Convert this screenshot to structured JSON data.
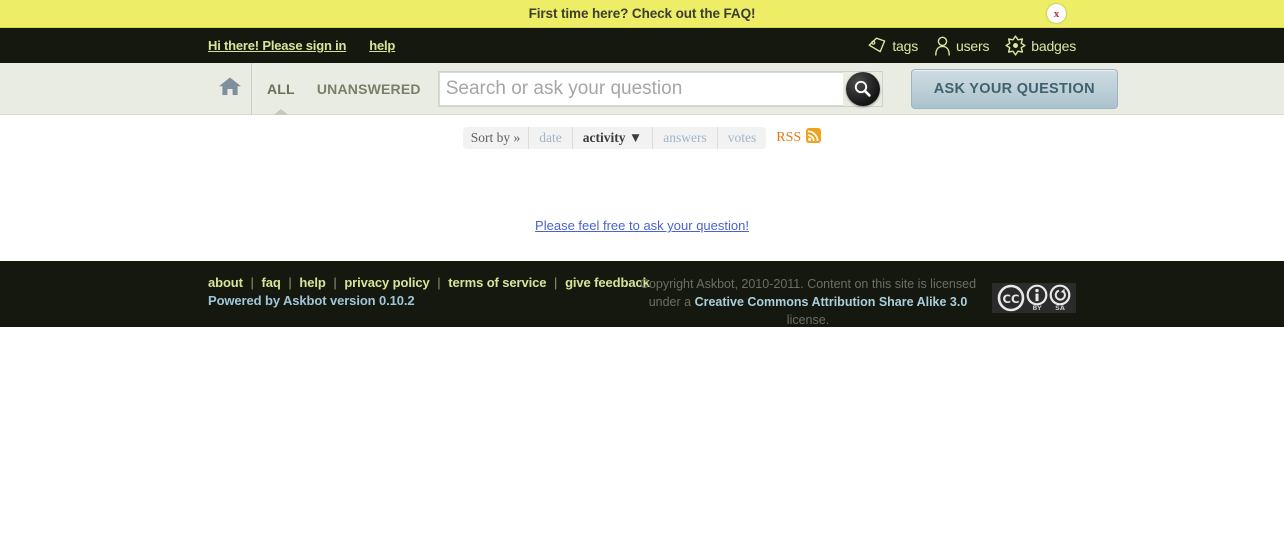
{
  "banner": {
    "text": "First time here? Check out the FAQ!",
    "close_label": "x",
    "background_color": "#eeee66"
  },
  "topnav": {
    "signin_label": "Hi there! Please sign in",
    "help_label": "help",
    "items": [
      {
        "label": "tags",
        "icon": "tag-icon"
      },
      {
        "label": "users",
        "icon": "user-icon"
      },
      {
        "label": "badges",
        "icon": "badge-icon"
      }
    ],
    "link_color": "#d6e49a",
    "background_color": "#15180f"
  },
  "toolbar": {
    "home_icon": "home-icon",
    "tabs": [
      {
        "label": "ALL",
        "active": true
      },
      {
        "label": "UNANSWERED",
        "active": false
      }
    ],
    "search": {
      "value": "",
      "placeholder": "Search or ask your question",
      "button_icon": "magnifier-icon"
    },
    "ask_button_label": "ASK YOUR QUESTION",
    "background_color": "#e9ece3"
  },
  "sortbar": {
    "label": "Sort by »",
    "options": [
      {
        "label": "date",
        "active": false
      },
      {
        "label": "activity ▼",
        "active": true
      },
      {
        "label": "answers",
        "active": false
      },
      {
        "label": "votes",
        "active": false
      }
    ],
    "rss_label": "RSS",
    "rss_icon": "rss-icon",
    "rss_color": "#e07b18"
  },
  "main": {
    "empty_message": "Please feel free to ask your question!"
  },
  "footer": {
    "links": [
      "about",
      "faq",
      "help",
      "privacy policy",
      "terms of service",
      "give feedback"
    ],
    "separator": "|",
    "powered_by": "Powered by Askbot version 0.10.2",
    "copyright_prefix": "Copyright Askbot, 2010-2011. Content on this site is licensed under a ",
    "license_link": "Creative Commons Attribution Share Alike 3.0",
    "copyright_suffix": " license.",
    "cc_badge": {
      "cc_label": "CC",
      "by_label": "BY",
      "sa_label": "SA"
    },
    "background_color": "#15180f"
  }
}
